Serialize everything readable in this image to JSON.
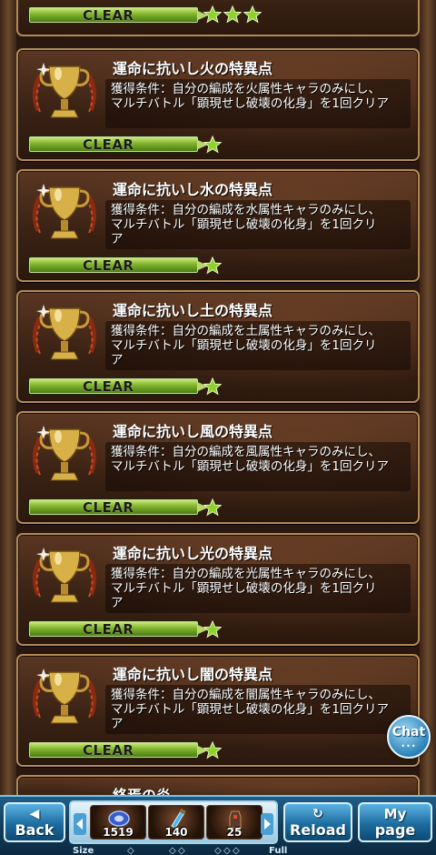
{
  "top_card": {
    "clear_label": "CLEAR",
    "stars": 3
  },
  "achievements": [
    {
      "title": "運命に抗いし火の特異点",
      "desc_line1": "獲得条件：自分の編成を火属性キャラのみにし、",
      "desc_line2": "マルチバトル「顕現せし破壊の化身」を1回クリア",
      "desc_line3": "",
      "clear_label": "CLEAR",
      "stars": 1
    },
    {
      "title": "運命に抗いし水の特異点",
      "desc_line1": "獲得条件：自分の編成を水属性キャラのみにし、",
      "desc_line2": "マルチバトル「顕現せし破壊の化身」を1回クリ",
      "desc_line3": "ア",
      "clear_label": "CLEAR",
      "stars": 1
    },
    {
      "title": "運命に抗いし土の特異点",
      "desc_line1": "獲得条件：自分の編成を土属性キャラのみにし、",
      "desc_line2": "マルチバトル「顕現せし破壊の化身」を1回クリ",
      "desc_line3": "ア",
      "clear_label": "CLEAR",
      "stars": 1
    },
    {
      "title": "運命に抗いし風の特異点",
      "desc_line1": "獲得条件：自分の編成を風属性キャラのみにし、",
      "desc_line2": "マルチバトル「顕現せし破壊の化身」を1回クリア",
      "desc_line3": "",
      "clear_label": "CLEAR",
      "stars": 1
    },
    {
      "title": "運命に抗いし光の特異点",
      "desc_line1": "獲得条件：自分の編成を光属性キャラのみにし、",
      "desc_line2": "マルチバトル「顕現せし破壊の化身」を1回クリ",
      "desc_line3": "ア",
      "clear_label": "CLEAR",
      "stars": 1
    },
    {
      "title": "運命に抗いし闇の特異点",
      "desc_line1": "獲得条件：自分の編成を闇属性キャラのみにし、",
      "desc_line2": "マルチバトル「顕現せし破壊の化身」を1回クリア",
      "desc_line3": "ア",
      "clear_label": "CLEAR",
      "stars": 1
    }
  ],
  "partial_card": {
    "title": "終焉の炎"
  },
  "chat": {
    "label": "Chat",
    "dots": "•••"
  },
  "bottom_bar": {
    "back": {
      "arrow": "◀",
      "label": "Back"
    },
    "items": [
      {
        "icon": "crystal-icon",
        "count": "1519"
      },
      {
        "icon": "potion-icon",
        "count": "140"
      },
      {
        "icon": "treasure-icon",
        "count": "25"
      }
    ],
    "reload": {
      "icon": "↻",
      "label": "Reload"
    },
    "mypage": {
      "line1": "My",
      "line2": "page"
    },
    "footer": {
      "size_label": "Size",
      "full_label": "Full",
      "diamond": "◇"
    }
  },
  "colors": {
    "card_border": "#b28a56",
    "clear_green": "#7fb32c",
    "star_green": "#8fd12c",
    "bottom_blue": "#1d6c9f"
  }
}
